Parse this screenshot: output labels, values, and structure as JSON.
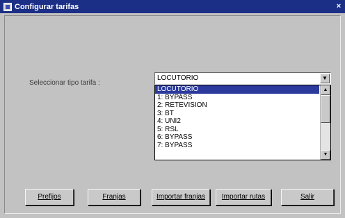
{
  "window": {
    "title": "Configurar tarifas",
    "close_label": "×"
  },
  "form": {
    "label": "Seleccionar tipo tarifa :"
  },
  "combo": {
    "value": "LOCUTORIO",
    "arrow": "▼",
    "options": [
      "LOCUTORIO",
      "1: BYPASS",
      "2: RETEVISION",
      "3: BT",
      "4: UNI2",
      "5: RSL",
      "6: BYPASS",
      "7: BYPASS"
    ],
    "selected_index": 0
  },
  "scrollbar": {
    "up": "▲",
    "down": "▼"
  },
  "buttons": {
    "prefijos": "Prefijos",
    "franjas": "Franjas",
    "importar_franjas": "Importar franjas",
    "importar_rutas": "Importar rutas",
    "salir": "Salir"
  },
  "colors": {
    "titlebar": "#1c2f86",
    "selection": "#2b3a9c",
    "face": "#c2c2c2"
  }
}
